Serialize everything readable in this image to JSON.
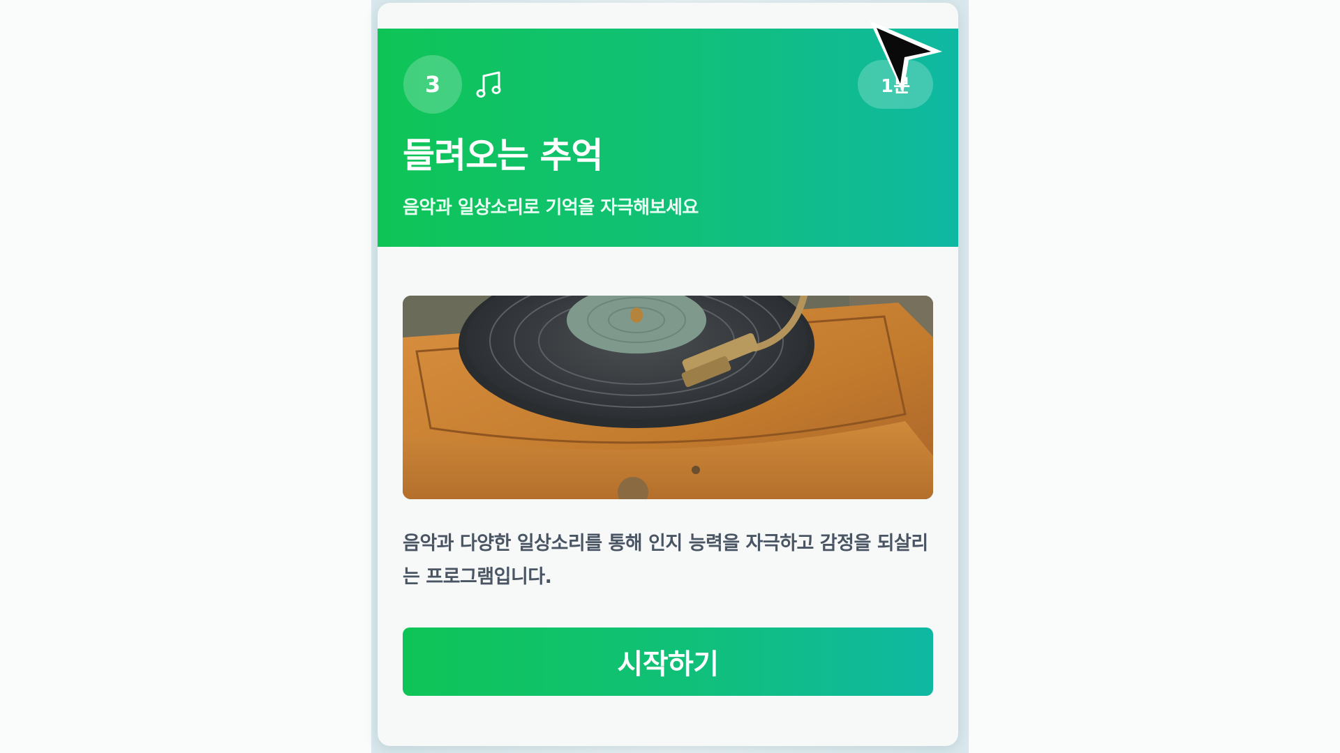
{
  "card": {
    "step_number": "3",
    "category_icon": "music-note-icon",
    "duration": "1분",
    "title": "들려오는 추억",
    "subtitle": "음악과 일상소리로 기억을 자극해보세요",
    "image_alt": "turntable-illustration",
    "description": "음악과 다양한 일상소리를 통해 인지 능력을 자극하고 감정을 되살리는 프로그램입니다.",
    "start_label": "시작하기"
  },
  "colors": {
    "accent_start": "#0fc456",
    "accent_end": "#0fb8a2",
    "description_text": "#4a5563"
  }
}
